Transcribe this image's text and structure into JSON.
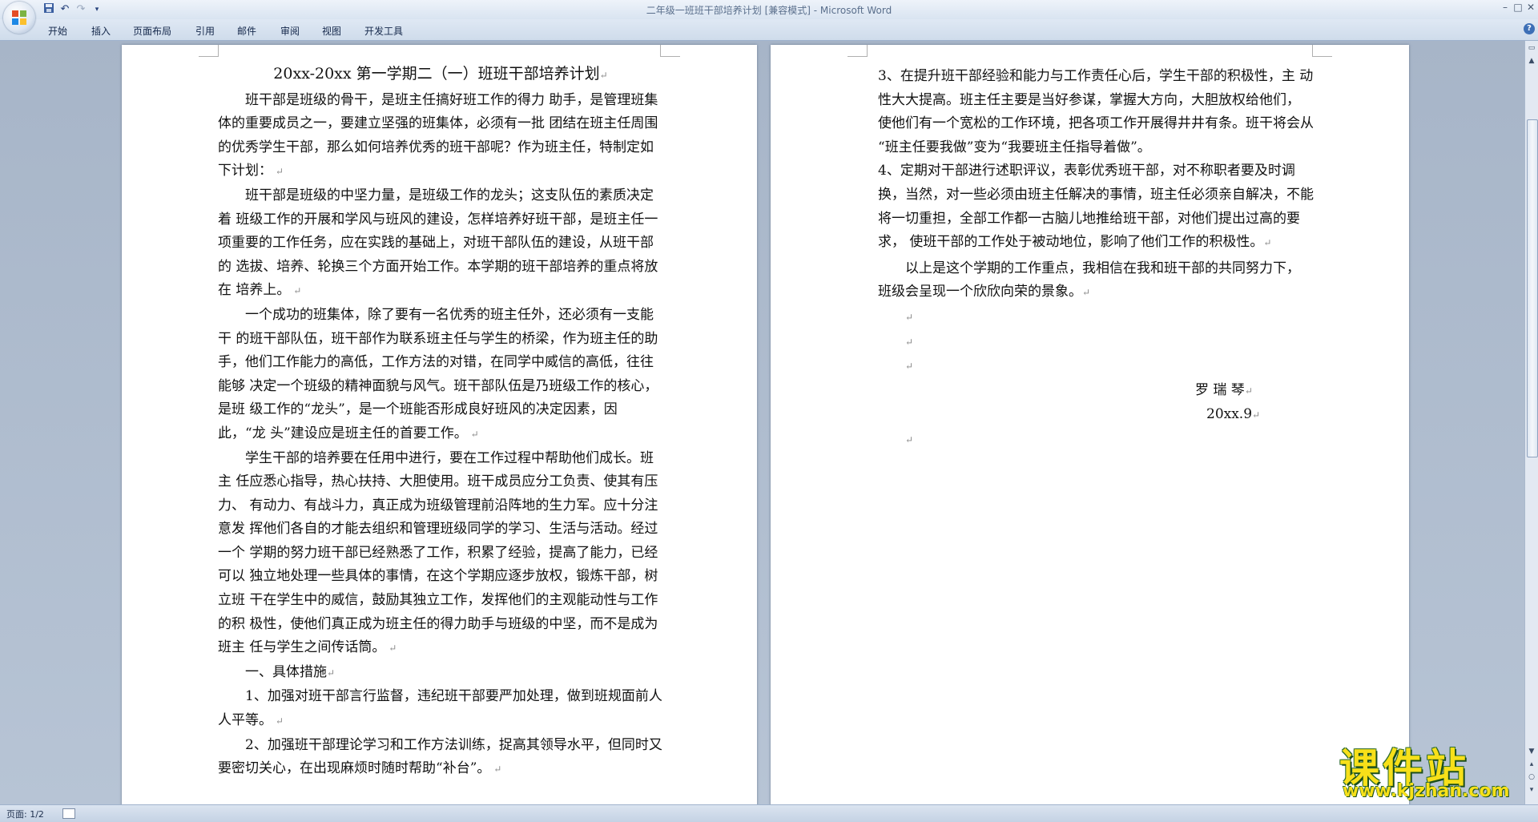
{
  "window": {
    "title": "二年级一班班干部培养计划 [兼容模式] - Microsoft Word",
    "controls": [
      "minimize-icon",
      "restore-icon",
      "close-icon"
    ]
  },
  "quick_access": [
    "save-icon",
    "undo-icon",
    "redo-icon",
    "customize-qat-icon"
  ],
  "ribbon": {
    "tabs": [
      "开始",
      "插入",
      "页面布局",
      "引用",
      "邮件",
      "审阅",
      "视图",
      "开发工具"
    ]
  },
  "document": {
    "page1": {
      "title": "20xx-20xx 第一学期二（一）班班干部培养计划",
      "paragraphs": [
        "　　班干部是班级的骨干，是班主任搞好班工作的得力 助手，是管理班集体的重要成员之一，要建立坚强的班集体，必须有一批 团结在班主任周围的优秀学生干部，那么如何培养优秀的班干部呢？作为班主任，特制定如下计划：",
        "　　班干部是班级的中坚力量，是班级工作的龙头；这支队伍的素质决定着 班级工作的开展和学风与班风的建设，怎样培养好班干部，是班主任一项重要的工作任务，应在实践的基础上，对班干部队伍的建设，从班干部的 选拔、培养、轮换三个方面开始工作。本学期的班干部培养的重点将放在 培养上。",
        "　　一个成功的班集体，除了要有一名优秀的班主任外，还必须有一支能干 的班干部队伍，班干部作为联系班主任与学生的桥梁，作为班主任的助手，他们工作能力的高低，工作方法的对错，在同学中威信的高低，往往能够 决定一个班级的精神面貌与风气。班干部队伍是乃班级工作的核心，是班 级工作的“龙头”，是一个班能否形成良好班风的决定因素，因此，“龙 头”建设应是班主任的首要工作。",
        "　　学生干部的培养要在任用中进行，要在工作过程中帮助他们成长。班主 任应悉心指导，热心扶持、大胆使用。班干成员应分工负责、使其有压力、 有动力、有战斗力，真正成为班级管理前沿阵地的生力军。应十分注意发 挥他们各自的才能去组织和管理班级同学的学习、生活与活动。经过一个 学期的努力班干部已经熟悉了工作，积累了经验，提高了能力，已经可以 独立地处理一些具体的事情，在这个学期应逐步放权，锻炼干部，树立班 干在学生中的威信，鼓励其独立工作，发挥他们的主观能动性与工作的积 极性，使他们真正成为班主任的得力助手与班级的中坚，而不是成为班主 任与学生之间传话筒。",
        "　　一、具体措施",
        "　　1、加强对班干部言行监督，违纪班干部要严加处理，做到班规面前人 人平等。",
        "　　2、加强班干部理论学习和工作方法训练，捉高其领导水平，但同时又 要密切关心，在出现麻烦时随时帮助“补台”。"
      ]
    },
    "page2": {
      "paragraphs": [
        "3、在提升班干部经验和能力与工作责任心后，学生干部的积极性，主 动性大大提高。班主任主要是当好参谋，掌握大方向，大胆放权给他们， 使他们有一个宽松的工作环境，把各项工作开展得井井有条。班干将会从 “班主任要我做”变为“我要班主任指导着做”。",
        "4、定期对干部进行述职评议，表彰优秀班干部，对不称职者要及时调 换，当然，对一些必须由班主任解决的事情，班主任必须亲自解决，不能 将一切重担，全部工作都一古脑儿地推给班干部，对他们提出过高的要求， 使班干部的工作处于被动地位，影响了他们工作的积极性。",
        "　　以上是这个学期的工作重点，我相信在我和班干部的共同努力下， 班级会呈现一个欣欣向荣的景象。"
      ],
      "signature_name": "罗 瑞 琴",
      "signature_date": "20xx.9"
    }
  },
  "statusbar": {
    "page_info": "页面: 1/2"
  },
  "watermark": {
    "main": "课件站",
    "url": "www.kjzhan.com"
  }
}
